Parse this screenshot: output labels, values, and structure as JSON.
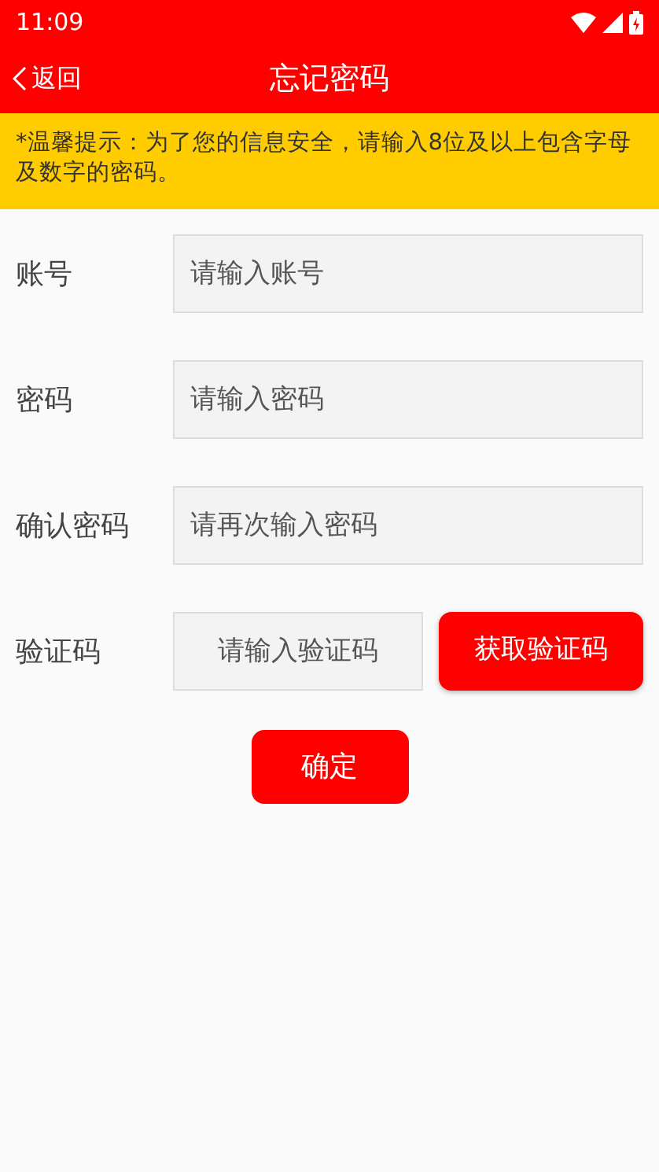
{
  "status_bar": {
    "time": "11:09"
  },
  "header": {
    "back": "返回",
    "title": "忘记密码"
  },
  "notice": "*温馨提示：为了您的信息安全，请输入8位及以上包含字母及数字的密码。",
  "fields": [
    {
      "kind": "text",
      "label": "账号",
      "placeholder": "请输入账号"
    },
    {
      "kind": "text",
      "label": "密码",
      "placeholder": "请输入密码"
    },
    {
      "kind": "text",
      "label": "确认密码",
      "placeholder": "请再次输入密码"
    },
    {
      "kind": "code",
      "label": "验证码",
      "placeholder": "请输入验证码",
      "button": "获取验证码"
    }
  ],
  "submit": "确定"
}
